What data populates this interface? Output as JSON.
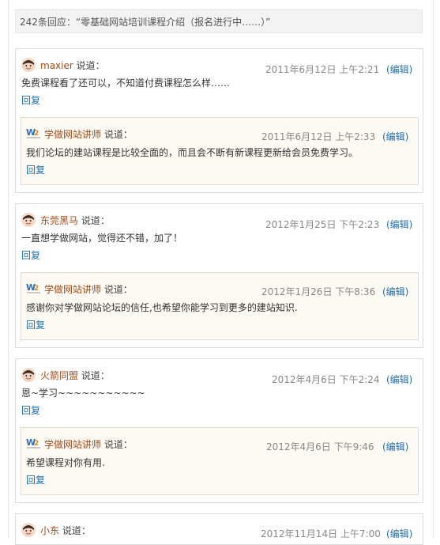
{
  "header": {
    "title": "242条回应：“零基础网站培训课程介绍（报名进行中……）”"
  },
  "comments": [
    {
      "author": "maxier",
      "says": "说道：",
      "date": "2011年6月12日 上午2:21",
      "edit": "(编辑)",
      "text": "免费课程看了还可以，不知道付费课程怎么样……",
      "reply": "回复",
      "child": {
        "author": "学做网站讲师",
        "says": "说道：",
        "date": "2011年6月12日 上午2:33",
        "edit": "(编辑)",
        "text": "我们论坛的建站课程是比较全面的，而且会不断有新课程更新给会员免费学习。",
        "reply": "回复"
      }
    },
    {
      "author": "东莞黑马",
      "says": "说道：",
      "date": "2012年1月25日 下午2:23",
      "edit": "(编辑)",
      "text": "一直想学做网站，觉得还不错，加了！",
      "reply": "回复",
      "child": {
        "author": "学做网站讲师",
        "says": "说道：",
        "date": "2012年1月26日 下午8:36",
        "edit": "(编辑)",
        "text": "感谢你对学做网站论坛的信任,也希望你能学习到更多的建站知识.",
        "reply": "回复"
      }
    },
    {
      "author": "火箭同盟",
      "says": "说道：",
      "date": "2012年4月6日 下午2:24",
      "edit": "(编辑)",
      "text": "恩~学习~~~~~~~~~~~",
      "reply": "回复",
      "child": {
        "author": "学做网站讲师",
        "says": "说道：",
        "date": "2012年4月6日 下午9:46",
        "edit": "(编辑)",
        "text": "希望课程对你有用.",
        "reply": "回复"
      }
    },
    {
      "author": "小东",
      "says": "说道：",
      "date": "2012年11月14日 上午7:00",
      "edit": "(编辑)"
    }
  ],
  "colors": {
    "author_link": "#a24a1b",
    "action_link": "#1f6fae",
    "child_bg": "#fdf9f3"
  }
}
